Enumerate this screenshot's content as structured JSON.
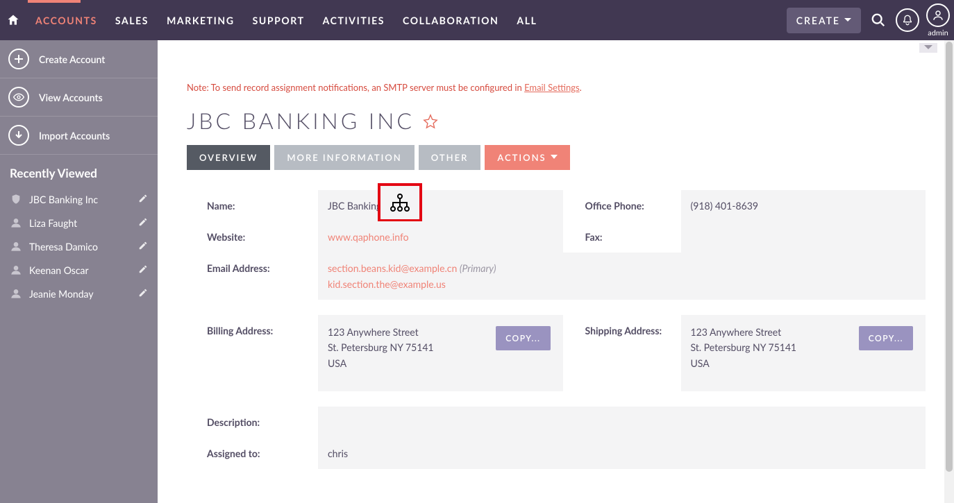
{
  "topnav": {
    "items": [
      "ACCOUNTS",
      "SALES",
      "MARKETING",
      "SUPPORT",
      "ACTIVITIES",
      "COLLABORATION",
      "ALL"
    ],
    "create_label": "CREATE",
    "user_label": "admin"
  },
  "sidebar": {
    "actions": {
      "create": "Create Account",
      "view": "View Accounts",
      "import": "Import Accounts"
    },
    "recent_heading": "Recently Viewed",
    "recent": [
      {
        "label": "JBC Banking Inc",
        "icon": "shield"
      },
      {
        "label": "Liza Faught",
        "icon": "person"
      },
      {
        "label": "Theresa Damico",
        "icon": "person"
      },
      {
        "label": "Keenan Oscar",
        "icon": "person"
      },
      {
        "label": "Jeanie Monday",
        "icon": "person"
      }
    ]
  },
  "note": {
    "prefix": "Note: To send record assignment notifications, an SMTP server must be configured in ",
    "link": "Email Settings",
    "suffix": "."
  },
  "title": "JBC BANKING INC",
  "tabs": {
    "overview": "OVERVIEW",
    "more": "MORE INFORMATION",
    "other": "OTHER",
    "actions": "ACTIONS"
  },
  "fields": {
    "name_label": "Name:",
    "name_value": "JBC Banking Inc",
    "office_phone_label": "Office Phone:",
    "office_phone_value": "(918) 401-8639",
    "website_label": "Website:",
    "website_value": "www.qaphone.info",
    "fax_label": "Fax:",
    "fax_value": "",
    "email_label": "Email Address:",
    "email_primary": "section.beans.kid@example.cn",
    "email_primary_note": "(Primary)",
    "email_secondary": "kid.section.the@example.us",
    "billing_label": "Billing Address:",
    "billing_line1": "123 Anywhere Street",
    "billing_line2": "St. Petersburg NY   75141",
    "billing_line3": "USA",
    "shipping_label": "Shipping Address:",
    "shipping_line1": "123 Anywhere Street",
    "shipping_line2": "St. Petersburg NY   75141",
    "shipping_line3": "USA",
    "copy_label": "COPY...",
    "description_label": "Description:",
    "description_value": "",
    "assigned_label": "Assigned to:",
    "assigned_value": "chris"
  }
}
